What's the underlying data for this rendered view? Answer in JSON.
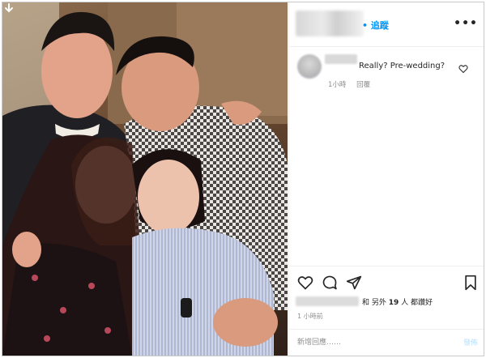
{
  "header": {
    "separator": "•",
    "follow_label": "追蹤",
    "more_icon": "more-options-icon",
    "more_glyph": "•••"
  },
  "comment": {
    "text": "Really? Pre-wedding?",
    "time": "1小時",
    "reply_label": "回覆"
  },
  "actions": {
    "icons": [
      "heart-icon",
      "comment-icon",
      "share-icon",
      "bookmark-icon"
    ],
    "likes_text_pre": "和 另外",
    "likes_count": "19",
    "likes_text_post": "人 都讚好",
    "time_ago": "1 小時前"
  },
  "add_comment": {
    "placeholder": "新增回應……",
    "post_label": "發佈"
  },
  "colors": {
    "accent": "#0095f6",
    "post_disabled": "#b2dffc",
    "muted": "#8e8e8e",
    "text": "#262626"
  }
}
